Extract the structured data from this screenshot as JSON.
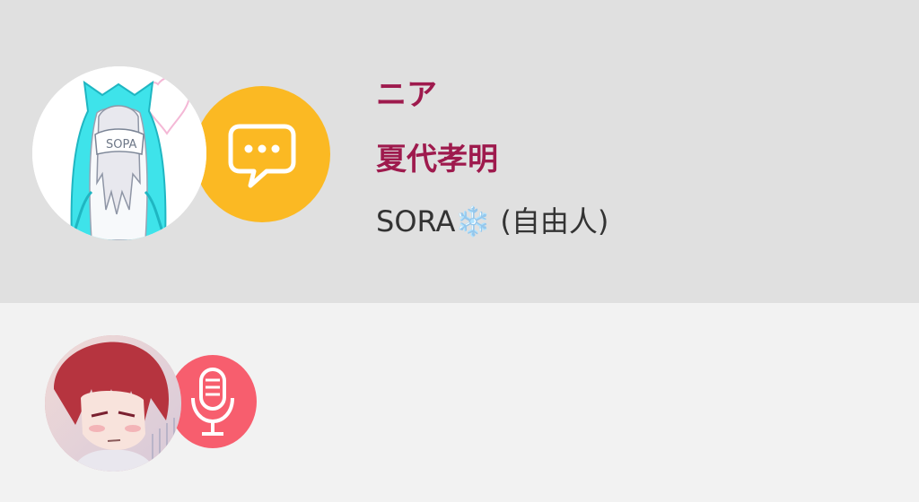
{
  "entries": [
    {
      "name_line_1": "ニア",
      "name_line_2": "夏代孝明",
      "status": "SORA❄️ (自由人)",
      "badge_icon": "chat-bubble-icon",
      "badge_color": "#fbb923"
    },
    {
      "badge_icon": "microphone-icon",
      "badge_color": "#f75e6e"
    }
  ],
  "colors": {
    "card_1_background": "#e0e0e0",
    "card_2_background": "#f2f2f2",
    "name_color": "#9e1a4d",
    "status_color": "#333333"
  }
}
